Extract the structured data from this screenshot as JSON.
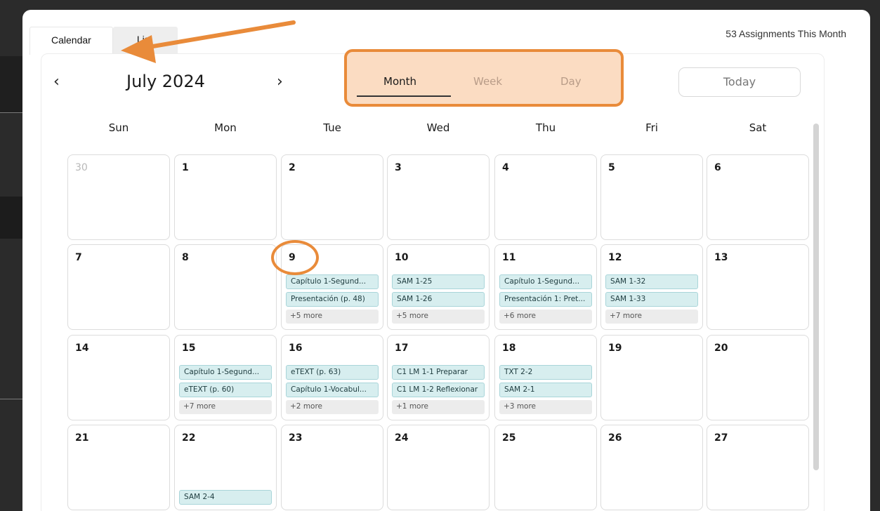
{
  "tabs": [
    {
      "label": "Calendar"
    },
    {
      "label": "List"
    }
  ],
  "assignment_count": "53 Assignments This Month",
  "nav": {
    "prev": "‹",
    "next": "›"
  },
  "month_title": "July 2024",
  "views": [
    {
      "label": "Month"
    },
    {
      "label": "Week"
    },
    {
      "label": "Day"
    }
  ],
  "today_label": "Today",
  "weekdays": [
    "Sun",
    "Mon",
    "Tue",
    "Wed",
    "Thu",
    "Fri",
    "Sat"
  ],
  "colors": {
    "accent": "#e98b3a",
    "chip": "#d7eeef",
    "segment_bg": "#fbdcc2"
  },
  "weeks": [
    {
      "days": [
        {
          "num": "30",
          "other": true,
          "items": [],
          "more": ""
        },
        {
          "num": "1",
          "items": [],
          "more": ""
        },
        {
          "num": "2",
          "items": [],
          "more": ""
        },
        {
          "num": "3",
          "items": [],
          "more": ""
        },
        {
          "num": "4",
          "items": [],
          "more": ""
        },
        {
          "num": "5",
          "items": [],
          "more": ""
        },
        {
          "num": "6",
          "items": [],
          "more": ""
        }
      ]
    },
    {
      "days": [
        {
          "num": "7",
          "items": [],
          "more": ""
        },
        {
          "num": "8",
          "items": [],
          "more": ""
        },
        {
          "num": "9",
          "items": [
            "Capítulo 1-Segund...",
            "Presentación (p. 48)"
          ],
          "more": "+5 more"
        },
        {
          "num": "10",
          "items": [
            "SAM 1-25",
            "SAM 1-26"
          ],
          "more": "+5 more"
        },
        {
          "num": "11",
          "items": [
            "Capítulo 1-Segund...",
            "Presentación 1: Pret..."
          ],
          "more": "+6 more"
        },
        {
          "num": "12",
          "items": [
            "SAM 1-32",
            "SAM 1-33"
          ],
          "more": "+7 more"
        },
        {
          "num": "13",
          "items": [],
          "more": ""
        }
      ]
    },
    {
      "days": [
        {
          "num": "14",
          "items": [],
          "more": ""
        },
        {
          "num": "15",
          "items": [
            "Capítulo 1-Segund...",
            "eTEXT (p. 60)"
          ],
          "more": "+7 more"
        },
        {
          "num": "16",
          "items": [
            "eTEXT (p. 63)",
            "Capítulo 1-Vocabul..."
          ],
          "more": "+2 more"
        },
        {
          "num": "17",
          "items": [
            "C1 LM 1-1 Preparar",
            "C1 LM 1-2 Reflexionar"
          ],
          "more": "+1 more"
        },
        {
          "num": "18",
          "items": [
            "TXT 2-2",
            "SAM 2-1"
          ],
          "more": "+3 more"
        },
        {
          "num": "19",
          "items": [],
          "more": ""
        },
        {
          "num": "20",
          "items": [],
          "more": ""
        }
      ]
    },
    {
      "days": [
        {
          "num": "21",
          "items": [],
          "more": ""
        },
        {
          "num": "22",
          "items": [],
          "more": "",
          "bottom_item": "SAM 2-4"
        },
        {
          "num": "23",
          "items": [],
          "more": ""
        },
        {
          "num": "24",
          "items": [],
          "more": ""
        },
        {
          "num": "25",
          "items": [],
          "more": ""
        },
        {
          "num": "26",
          "items": [],
          "more": ""
        },
        {
          "num": "27",
          "items": [],
          "more": ""
        }
      ]
    }
  ]
}
